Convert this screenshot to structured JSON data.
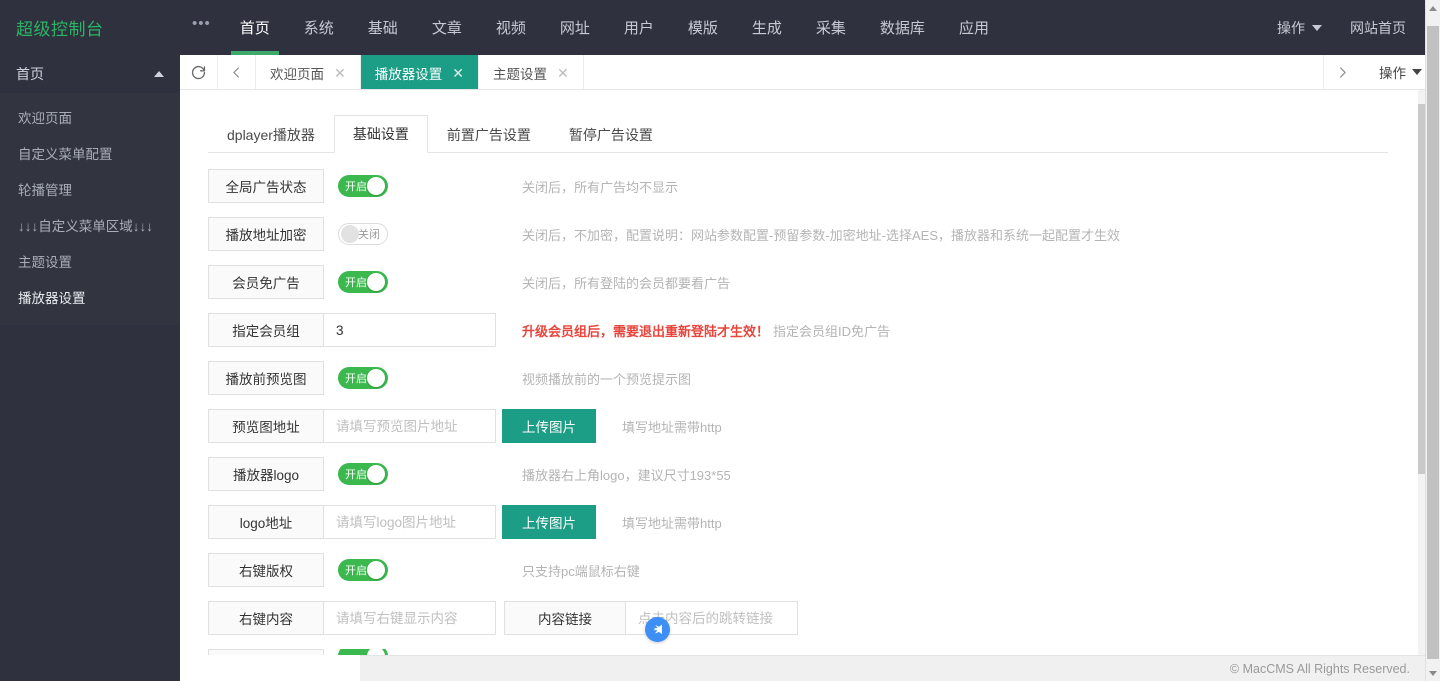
{
  "topnav": {
    "brand": "超级控制台",
    "dots": "•••",
    "items": [
      {
        "label": "首页",
        "active": true
      },
      {
        "label": "系统",
        "active": false
      },
      {
        "label": "基础",
        "active": false
      },
      {
        "label": "文章",
        "active": false
      },
      {
        "label": "视频",
        "active": false
      },
      {
        "label": "网址",
        "active": false
      },
      {
        "label": "用户",
        "active": false
      },
      {
        "label": "模版",
        "active": false
      },
      {
        "label": "生成",
        "active": false
      },
      {
        "label": "采集",
        "active": false
      },
      {
        "label": "数据库",
        "active": false
      },
      {
        "label": "应用",
        "active": false
      }
    ],
    "right": [
      {
        "label": "操作",
        "caret": true
      },
      {
        "label": "网站首页",
        "caret": false
      }
    ]
  },
  "sidebar": {
    "group_title": "首页",
    "items": [
      {
        "label": "欢迎页面",
        "active": false
      },
      {
        "label": "自定义菜单配置",
        "active": false
      },
      {
        "label": "轮播管理",
        "active": false
      },
      {
        "label": "↓↓↓自定义菜单区域↓↓↓",
        "active": false
      },
      {
        "label": "主题设置",
        "active": false
      },
      {
        "label": "播放器设置",
        "active": true
      }
    ]
  },
  "tabstrip": {
    "tabs": [
      {
        "label": "欢迎页面",
        "active": false
      },
      {
        "label": "播放器设置",
        "active": true
      },
      {
        "label": "主题设置",
        "active": false
      }
    ],
    "close_glyph": "✕",
    "operation_label": "操作"
  },
  "subtabs": [
    {
      "label": "dplayer播放器",
      "active": false
    },
    {
      "label": "基础设置",
      "active": true
    },
    {
      "label": "前置广告设置",
      "active": false
    },
    {
      "label": "暂停广告设置",
      "active": false
    }
  ],
  "switch_labels": {
    "on": "开启",
    "off": "关闭"
  },
  "form": {
    "rows": [
      {
        "label": "全局广告状态",
        "type": "switch",
        "state": "on",
        "hint": "关闭后，所有广告均不显示"
      },
      {
        "label": "播放地址加密",
        "type": "switch",
        "state": "off",
        "hint": "关闭后，不加密，配置说明：网站参数配置-预留参数-加密地址-选择AES，播放器和系统一起配置才生效"
      },
      {
        "label": "会员免广告",
        "type": "switch",
        "state": "on",
        "hint": "关闭后，所有登陆的会员都要看广告"
      },
      {
        "label": "指定会员组",
        "type": "input",
        "value": "3",
        "placeholder": "",
        "hint_warn": "升级会员组后，需要退出重新登陆才生效！",
        "hint": "指定会员组ID免广告"
      },
      {
        "label": "播放前预览图",
        "type": "switch",
        "state": "on",
        "hint": "视频播放前的一个预览提示图"
      },
      {
        "label": "预览图地址",
        "type": "input-upload",
        "value": "",
        "placeholder": "请填写预览图片地址",
        "button": "上传图片",
        "hint": "填写地址需带http"
      },
      {
        "label": "播放器logo",
        "type": "switch",
        "state": "on",
        "hint": "播放器右上角logo，建议尺寸193*55"
      },
      {
        "label": "logo地址",
        "type": "input-upload",
        "value": "",
        "placeholder": "请填写logo图片地址",
        "button": "上传图片",
        "hint": "填写地址需带http"
      },
      {
        "label": "右键版权",
        "type": "switch",
        "state": "on",
        "hint": "只支持pc端鼠标右键"
      },
      {
        "label": "右键内容",
        "type": "input-double",
        "value": "",
        "placeholder": "请填写右键显示内容",
        "label2": "内容链接",
        "value2": "",
        "placeholder2": "点击内容后的跳转链接"
      }
    ]
  },
  "fab": {
    "icon": "send-plane-icon"
  },
  "footer": {
    "text": "© MacCMS All Rights Reserved."
  },
  "colors": {
    "brand_green": "#2ab464",
    "accent_teal": "#1c9d86",
    "switch_on": "#3bb94e",
    "warn_red": "#e8453c",
    "dark_nav": "#2f323e",
    "fab_blue": "#3d8ef5"
  }
}
